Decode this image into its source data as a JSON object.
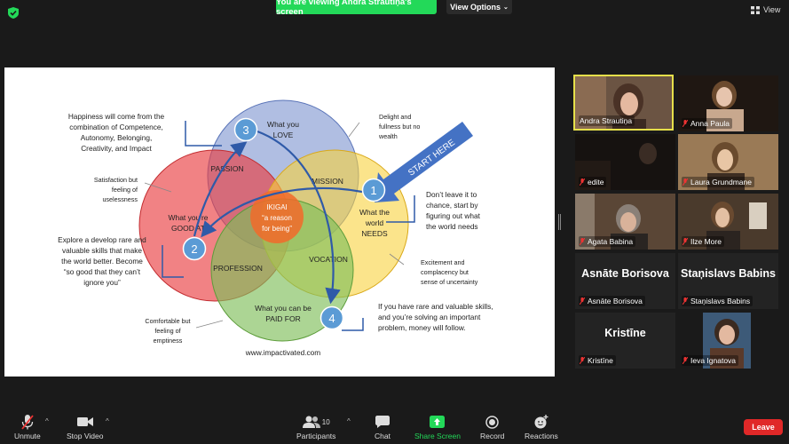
{
  "top_bar": {
    "banner": "You are viewing Andra Strautiņa's screen",
    "view_options": "View Options",
    "view_label": "View",
    "banner_color": "#23d959"
  },
  "slide": {
    "circle_love": "What you",
    "circle_love_2": "LOVE",
    "circle_good": "What you're",
    "circle_good_2": "GOOD AT",
    "circle_needs": "What the",
    "circle_needs_2": "world",
    "circle_needs_3": "NEEDS",
    "circle_paid": "What you can be",
    "circle_paid_2": "PAID FOR",
    "passion": "PASSION",
    "mission": "MISSION",
    "profession": "PROFESSION",
    "vocation": "VOCATION",
    "ikigai": "IKIGAI",
    "ikigai_sub": "“a reason",
    "ikigai_sub_2": "for being”",
    "start_here": "START HERE",
    "n1": "1",
    "n2": "2",
    "n3": "3",
    "n4": "4",
    "note_happiness": [
      "Happiness will come from the",
      "combination of Competence,",
      "Autonomy, Belonging,",
      "Creativity, and Impact"
    ],
    "note_delight": [
      "Delight and",
      "fullness but no",
      "wealth"
    ],
    "note_satisfaction": [
      "Satisfaction but",
      "feeling of",
      "uselessness"
    ],
    "note_dont": [
      "Don’t leave it to",
      "chance, start by",
      "figuring out what",
      "the world needs"
    ],
    "note_explore": [
      "Explore a develop rare and",
      "valuable skills that make",
      "the world better.  Become",
      "“so good that they can’t",
      "ignore you”"
    ],
    "note_excitement": [
      "Excitement and",
      "complacency but",
      "sense of uncertainty"
    ],
    "note_comfortable": [
      "Comfortable but",
      "feeling of",
      "emptiness"
    ],
    "note_rare": [
      "If you have rare and valuable skills,",
      "and you’re solving an important",
      "problem,  money will follow."
    ],
    "website": "www.impactivated.com"
  },
  "participants": [
    {
      "name": "Andra Strautiņa",
      "type": "video",
      "muted": false,
      "active": true
    },
    {
      "name": "Anna Paula",
      "type": "video",
      "muted": true
    },
    {
      "name": "edite",
      "type": "video",
      "muted": true
    },
    {
      "name": "Laura Grundmane",
      "type": "video",
      "muted": true
    },
    {
      "name": "Agata Babina",
      "type": "video",
      "muted": true
    },
    {
      "name": "Ilze More",
      "type": "video",
      "muted": true
    },
    {
      "name": "Asnāte Borisova",
      "type": "name",
      "big": "Asnāte Borisova",
      "muted": true
    },
    {
      "name": "Staņislavs Babins",
      "type": "name",
      "big": "Staņislavs Babins",
      "muted": true
    },
    {
      "name": "Kristīne",
      "type": "name",
      "big": "Kristīne",
      "muted": true
    },
    {
      "name": "Ieva Ignatova",
      "type": "video",
      "muted": true
    }
  ],
  "toolbar": {
    "unmute": "Unmute",
    "stop_video": "Stop Video",
    "participants": "Participants",
    "participants_count": "10",
    "chat": "Chat",
    "share_screen": "Share Screen",
    "record": "Record",
    "reactions": "Reactions",
    "leave": "Leave",
    "leave_color": "#e02828",
    "share_color": "#23d959"
  }
}
